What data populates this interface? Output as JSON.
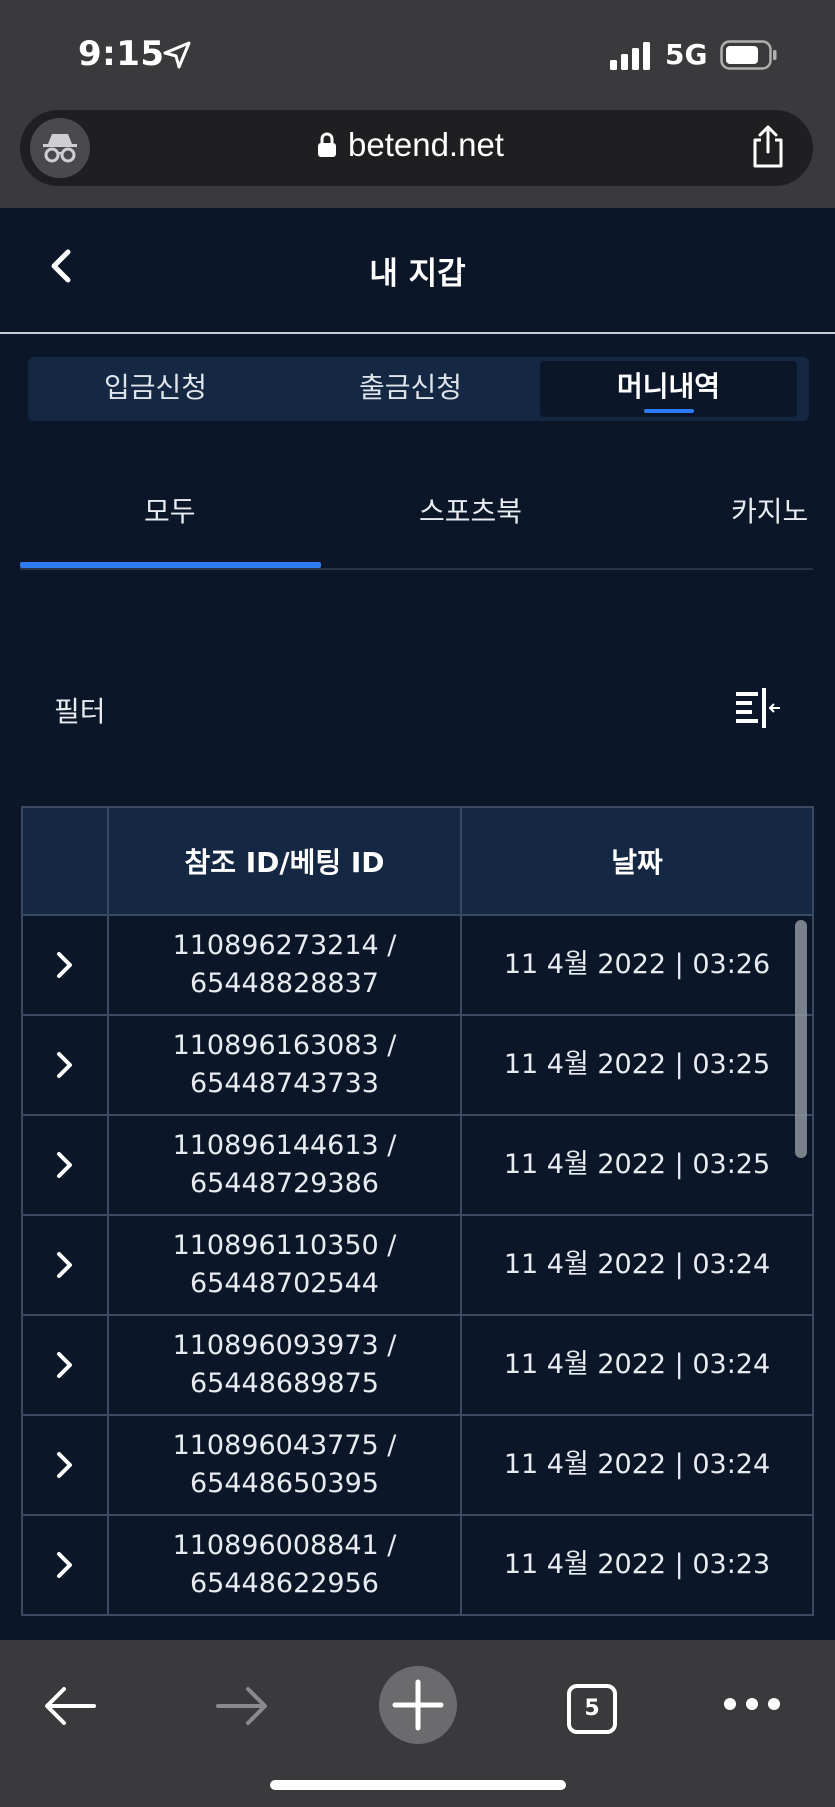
{
  "status_bar": {
    "time": "9:15",
    "network": "5G"
  },
  "browser": {
    "url": "betend.net"
  },
  "header": {
    "title": "내 지갑"
  },
  "wallet_tabs": [
    {
      "label": "입금신청",
      "active": false
    },
    {
      "label": "출금신청",
      "active": false
    },
    {
      "label": "머니내역",
      "active": true
    }
  ],
  "category_tabs": [
    {
      "label": "모두",
      "active": true
    },
    {
      "label": "스포츠북",
      "active": false
    },
    {
      "label": "카지노",
      "active": false
    }
  ],
  "filter": {
    "label": "필터"
  },
  "table": {
    "headers": [
      "참조 ID/베팅 ID",
      "날짜"
    ],
    "rows": [
      {
        "ref_id": "110896273214 /",
        "bet_id": "65448828837",
        "date": "11 4월 2022 | 03:26"
      },
      {
        "ref_id": "110896163083 /",
        "bet_id": "65448743733",
        "date": "11 4월 2022 | 03:25"
      },
      {
        "ref_id": "110896144613 /",
        "bet_id": "65448729386",
        "date": "11 4월 2022 | 03:25"
      },
      {
        "ref_id": "110896110350 /",
        "bet_id": "65448702544",
        "date": "11 4월 2022 | 03:24"
      },
      {
        "ref_id": "110896093973 /",
        "bet_id": "65448689875",
        "date": "11 4월 2022 | 03:24"
      },
      {
        "ref_id": "110896043775 /",
        "bet_id": "65448650395",
        "date": "11 4월 2022 | 03:24"
      },
      {
        "ref_id": "110896008841 /",
        "bet_id": "65448622956",
        "date": "11 4월 2022 | 03:23"
      }
    ]
  },
  "bottom_bar": {
    "tab_count": "5"
  },
  "colors": {
    "background": "#0b1628",
    "accent": "#2f7bf5",
    "panel": "#142743",
    "chrome": "#3a3a3c"
  }
}
